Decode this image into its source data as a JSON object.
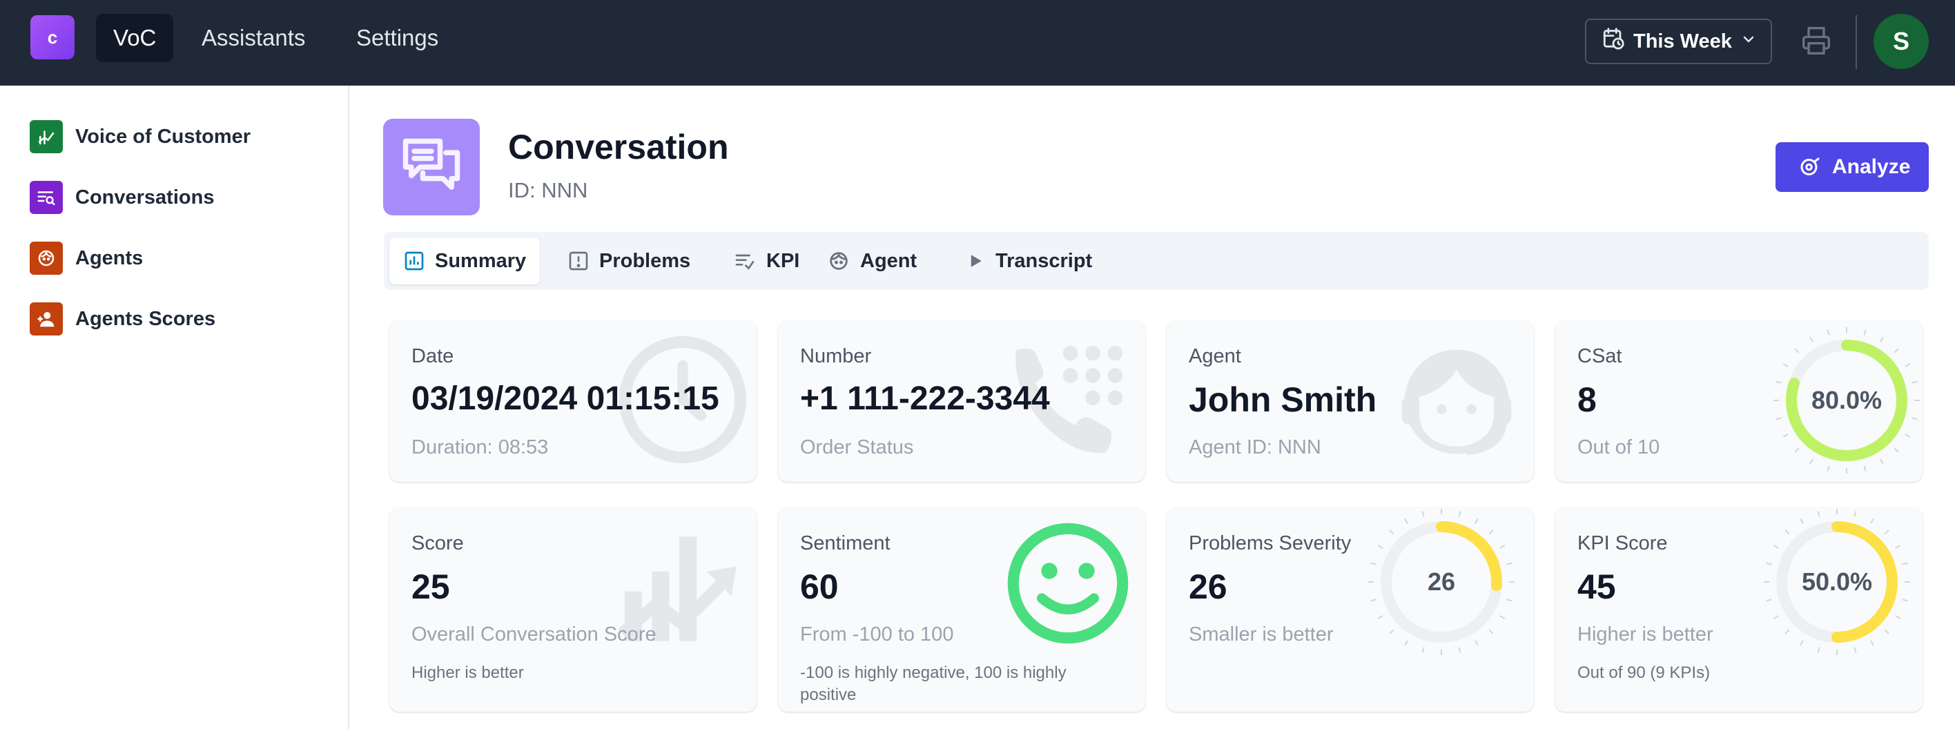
{
  "topbar": {
    "logo_letter": "c",
    "nav": [
      "VoC",
      "Assistants",
      "Settings"
    ],
    "period_label": "This Week",
    "avatar_initial": "S"
  },
  "sidebar": {
    "items": [
      {
        "label": "Voice of Customer",
        "color": "#15803d"
      },
      {
        "label": "Conversations",
        "color": "#7e22ce"
      },
      {
        "label": "Agents",
        "color": "#c2410c"
      },
      {
        "label": "Agents Scores",
        "color": "#c2410c"
      }
    ]
  },
  "header": {
    "title": "Conversation",
    "id": "ID: NNN",
    "analyze_label": "Analyze"
  },
  "tabs": [
    "Summary",
    "Problems",
    "KPI",
    "Agent",
    "Transcript"
  ],
  "cards": {
    "date": {
      "label": "Date",
      "value": "03/19/2024 01:15:15",
      "sub": "Duration: 08:53"
    },
    "number": {
      "label": "Number",
      "value": "+1 111-222-3344",
      "sub": "Order Status"
    },
    "agent": {
      "label": "Agent",
      "value": "John Smith",
      "sub": "Agent ID: NNN"
    },
    "csat": {
      "label": "CSat",
      "value": "8",
      "sub": "Out of 10",
      "gauge_text": "80.0%",
      "gauge_fraction": 0.8,
      "gauge_color": "#bef264"
    },
    "score": {
      "label": "Score",
      "value": "25",
      "sub": "Overall Conversation Score",
      "note": "Higher is better"
    },
    "sentiment": {
      "label": "Sentiment",
      "value": "60",
      "sub": "From -100 to 100",
      "note": "-100 is highly negative, 100 is highly positive"
    },
    "severity": {
      "label": "Problems Severity",
      "value": "26",
      "sub": "Smaller is better",
      "gauge_text": "26",
      "gauge_fraction": 0.26,
      "gauge_color": "#fde047"
    },
    "kpi": {
      "label": "KPI Score",
      "value": "45",
      "sub": "Higher is better",
      "note": "Out of 90 (9 KPIs)",
      "gauge_text": "50.0%",
      "gauge_fraction": 0.5,
      "gauge_color": "#fde047"
    }
  }
}
